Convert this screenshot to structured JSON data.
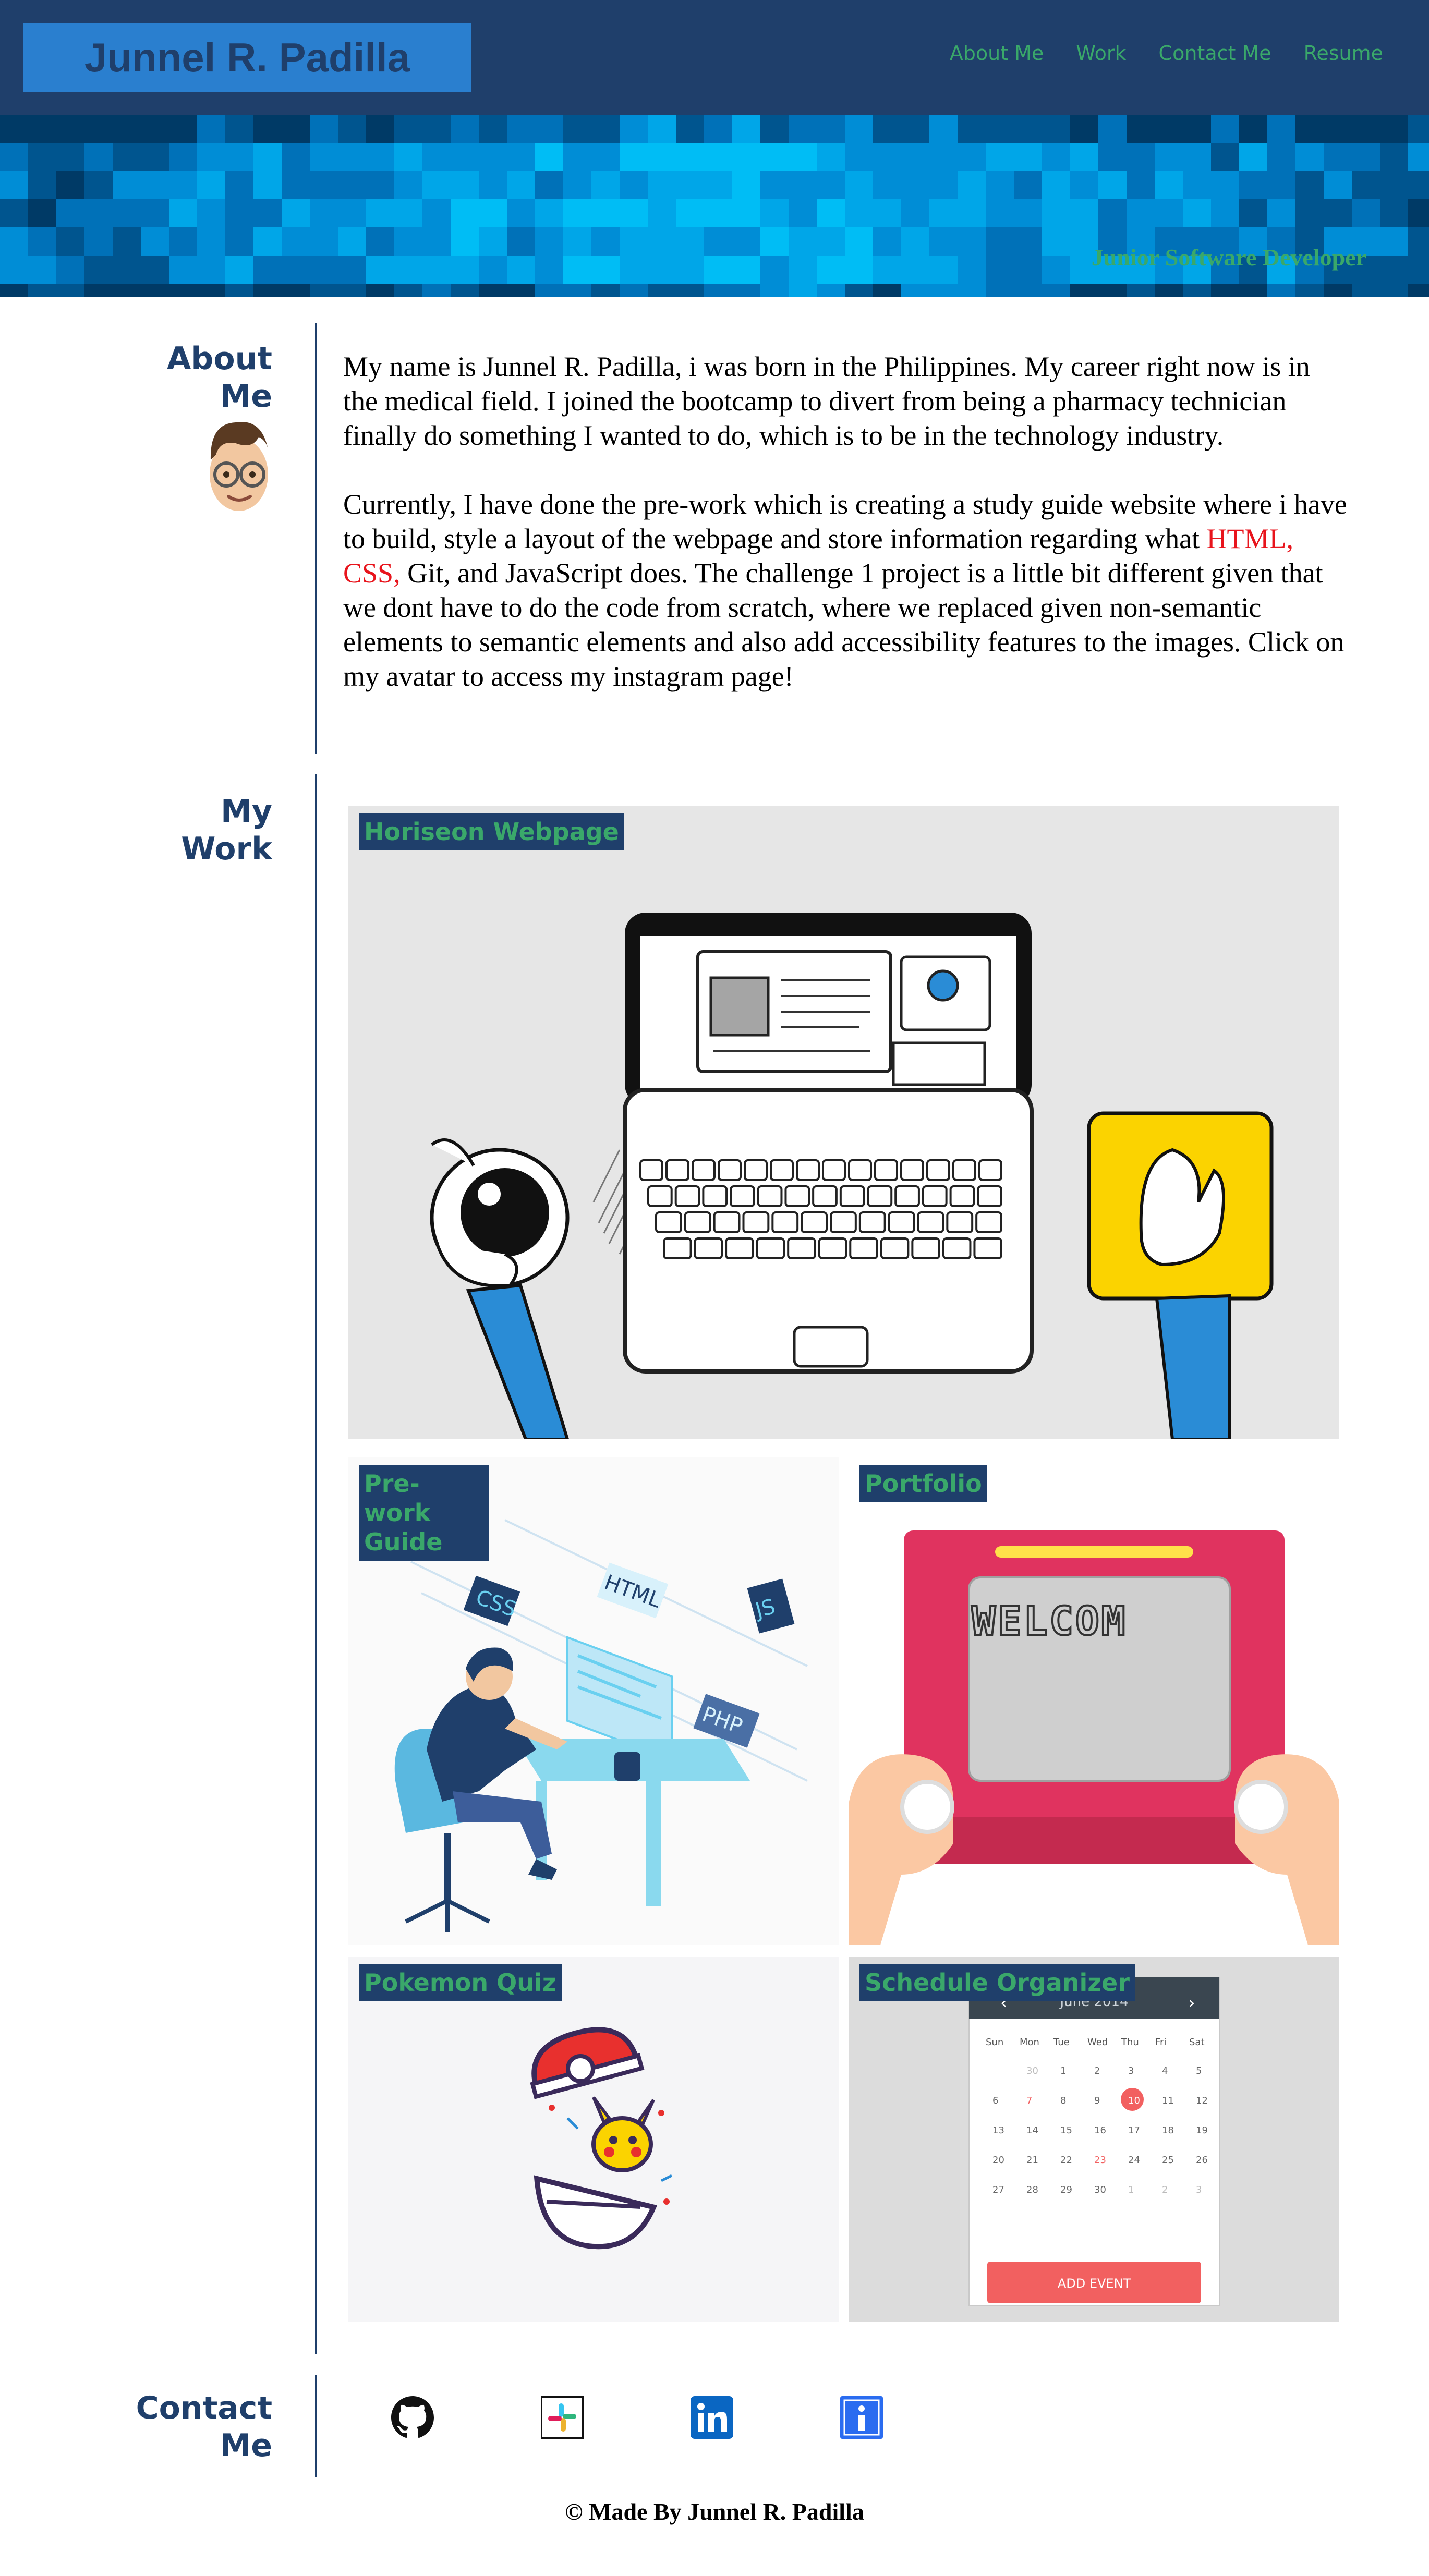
{
  "header": {
    "name": "Junnel R. Padilla",
    "nav": [
      "About Me",
      "Work",
      "Contact Me",
      "Resume"
    ]
  },
  "hero": {
    "subtitle": "Junior Software Developer"
  },
  "about": {
    "title_line1": "About",
    "title_line2": "Me",
    "paragraph1": "My name is Junnel R. Padilla, i was born in the Philippines. My career right now is in the medical field. I joined the bootcamp to divert from being a pharmacy technician finally do something I wanted to do, which is to be in the technology industry.",
    "paragraph2_start": "Currently, I have done the pre-work which is creating a study guide website where i have to build, style a layout of the webpage and store information regarding what ",
    "paragraph2_highlight": "HTML, CSS,",
    "paragraph2_end": " Git, and JavaScript does. The challenge 1 project is a little bit different given that we dont have to do the code from scratch, where we replaced given non-semantic elements to semantic elements and also add accessibility features to the images. Click on my avatar to access my instagram page!",
    "avatar_icon": "memoji-avatar-icon"
  },
  "work": {
    "title_line1": "My",
    "title_line2": "Work",
    "projects": [
      {
        "label": "Horiseon Webpage",
        "illustration": "laptop-coffee-illustration"
      },
      {
        "label": "Pre-work Guide",
        "illustration": "developer-desk-illustration"
      },
      {
        "label": "Portfolio",
        "illustration": "etch-a-sketch-welcome-illustration"
      },
      {
        "label": "Pokemon Quiz",
        "illustration": "pokeball-pikachu-illustration"
      },
      {
        "label": "Schedule Organizer",
        "illustration": "calendar-illustration"
      }
    ],
    "code_badges": [
      "CSS",
      "HTML",
      "JS",
      "PHP"
    ],
    "etch_text": "WELCOM",
    "calendar": {
      "month": "June 2014",
      "weekdays": [
        "Sun",
        "Mon",
        "Tue",
        "Wed",
        "Thu",
        "Fri",
        "Sat"
      ],
      "button": "ADD EVENT"
    }
  },
  "contact": {
    "title_line1": "Contact",
    "title_line2": "Me",
    "icons": [
      "github-icon",
      "slack-icon",
      "linkedin-icon",
      "info-icon"
    ]
  },
  "footer": {
    "text": "© Made By Junnel R. Padilla"
  },
  "colors": {
    "navy": "#1f3f6b",
    "brand_blue": "#2a7fcf",
    "green": "#3aa86a",
    "red": "#e8141c"
  }
}
